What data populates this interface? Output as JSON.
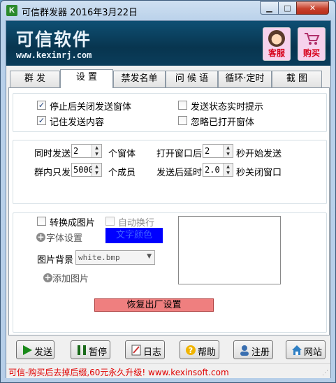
{
  "window": {
    "title": "可信群发器 2016年3月22日",
    "app_icon": "K"
  },
  "banner": {
    "brand": "可信软件",
    "url": "www.kexinrj.com",
    "service_label": "客服",
    "buy_label": "购买"
  },
  "tabs": [
    "群 发",
    "设 置",
    "禁发名单",
    "问 候 语",
    "循环·定时",
    "截 图"
  ],
  "options": {
    "close_after_stop": "停止后关闭发送窗体",
    "realtime_status": "发送状态实时提示",
    "remember_content": "记住发送内容",
    "ignore_open_windows": "忽略已打开窗体"
  },
  "timing": {
    "simultaneous_label": "同时发送",
    "simultaneous_value": "2",
    "window_unit": "个窗体",
    "after_open_label": "打开窗口后",
    "after_open_value": "2",
    "after_open_unit": "秒开始发送",
    "group_only_label": "群内只发",
    "group_only_value": "5000",
    "member_unit": "个成员",
    "after_send_label": "发送后延时",
    "after_send_value": "2.0",
    "after_send_unit": "秒关闭窗口"
  },
  "image": {
    "convert_label": "转换成图片",
    "autowrap_label": "自动换行",
    "font_settings": "字体设置",
    "text_color_label": "文字颜色",
    "bg_label": "图片背景",
    "bg_value": "white.bmp",
    "add_image": "添加图片",
    "reset": "恢复出厂设置"
  },
  "actions": {
    "send": "发送",
    "pause": "暂停",
    "log": "日志",
    "help": "帮助",
    "register": "注册",
    "website": "网站"
  },
  "status": "可信-购买后去掉后缀,60元永久升级! www.kexinsoft.com",
  "colors": {
    "text_color_swatch": "#0000ff",
    "reset_button": "#ef7f7f",
    "status_text": "#e00000"
  }
}
